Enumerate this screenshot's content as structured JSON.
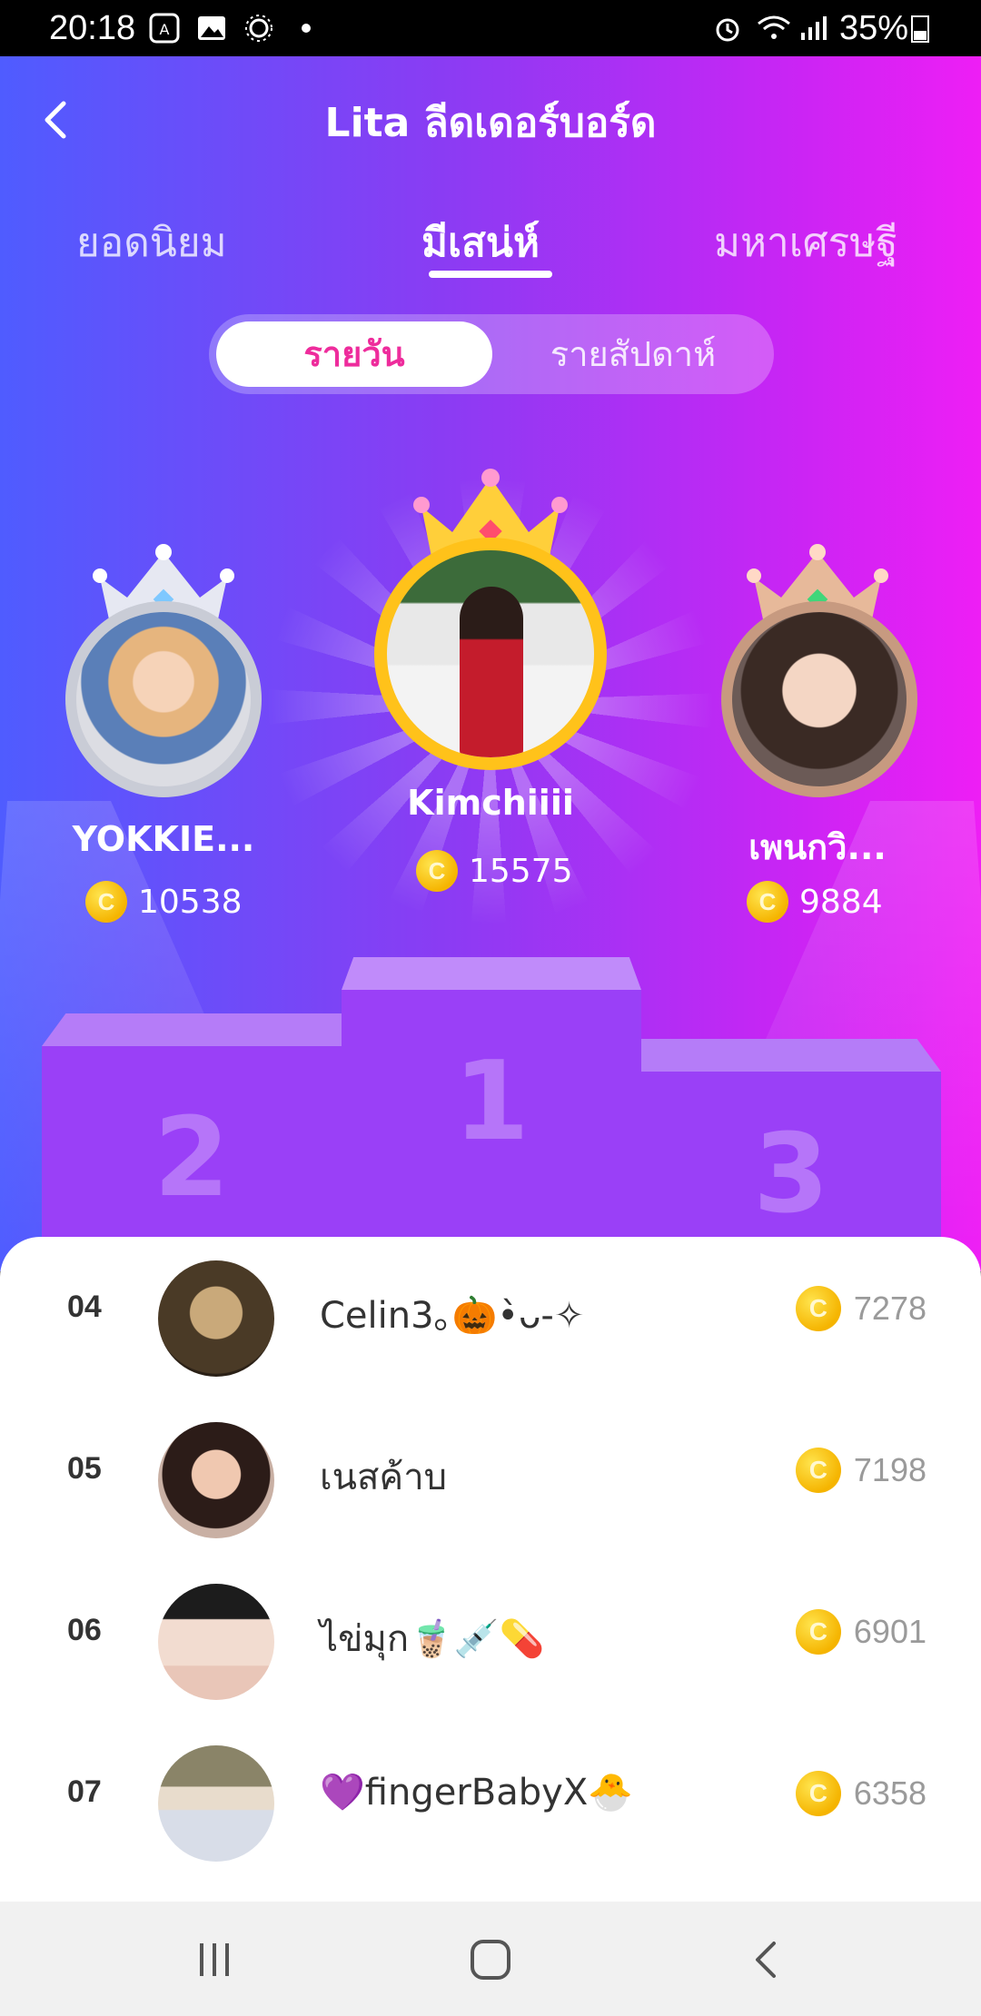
{
  "status_bar": {
    "time": "20:18",
    "battery": "35%"
  },
  "header": {
    "title": "Lita ลีดเดอร์บอร์ด"
  },
  "tabs": [
    {
      "label": "ยอดนิยม"
    },
    {
      "label": "มีเสน่ห์"
    },
    {
      "label": "มหาเศรษฐี"
    }
  ],
  "period_toggle": {
    "daily": "รายวัน",
    "weekly": "รายสัปดาห์"
  },
  "top3": [
    {
      "rank": "2",
      "name": "YOKKIE...",
      "score": "10538"
    },
    {
      "rank": "1",
      "name": "Kimchiiii",
      "score": "15575"
    },
    {
      "rank": "3",
      "name": "เพนกวิ...",
      "score": "9884"
    }
  ],
  "list": [
    {
      "rank": "04",
      "name": "Celin3｡🎃•̀ᴗ-✧",
      "score": "7278"
    },
    {
      "rank": "05",
      "name": "เนสค้าบ",
      "score": "7198"
    },
    {
      "rank": "06",
      "name": "ไข่มุก🧋💉💊",
      "score": "6901"
    },
    {
      "rank": "07",
      "name": "💜fingerBabyX🐣",
      "score": "6358"
    }
  ],
  "colors": {
    "accent_pink": "#ee2c9c",
    "gold": "#f5b400",
    "podium": "#9a40f7"
  }
}
